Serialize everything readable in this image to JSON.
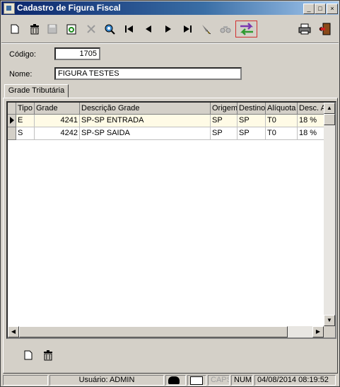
{
  "window": {
    "title": "Cadastro de Figura Fiscal"
  },
  "titlebar_buttons": [
    "_",
    "□",
    "×"
  ],
  "toolbar": {
    "icons": [
      "new-icon",
      "delete-icon",
      "save-icon",
      "refresh-icon",
      "cancel-icon",
      "search-icon",
      "first-icon",
      "prev-icon",
      "next-icon",
      "last-icon",
      "filter-icon",
      "find-icon",
      "transfer-icon",
      "print-icon",
      "exit-icon"
    ]
  },
  "form": {
    "codigo_label": "Código:",
    "codigo_value": "1705",
    "nome_label": "Nome:",
    "nome_value": "FIGURA TESTES"
  },
  "tab": {
    "label": "Grade Tributária"
  },
  "grid": {
    "columns": [
      "Tipo",
      "Grade",
      "Descrição Grade",
      "Origem",
      "Destino",
      "Alíquota",
      "Desc. A"
    ],
    "rows": [
      {
        "tipo": "E",
        "grade": "4241",
        "descricao": "SP-SP ENTRADA",
        "origem": "SP",
        "destino": "SP",
        "aliquota": "T0",
        "desc": "18 %"
      },
      {
        "tipo": "S",
        "grade": "4242",
        "descricao": "SP-SP SAIDA",
        "origem": "SP",
        "destino": "SP",
        "aliquota": "T0",
        "desc": "18 %"
      }
    ]
  },
  "statusbar": {
    "user": "Usuário: ADMIN",
    "caps": "CAPS",
    "num": "NUM",
    "datetime": "04/08/2014 08:19:52"
  },
  "colors": {
    "title_start": "#0a246a",
    "title_end": "#a6caf0",
    "row_highlight": "#fffbe6",
    "face": "#d4d0c8"
  }
}
